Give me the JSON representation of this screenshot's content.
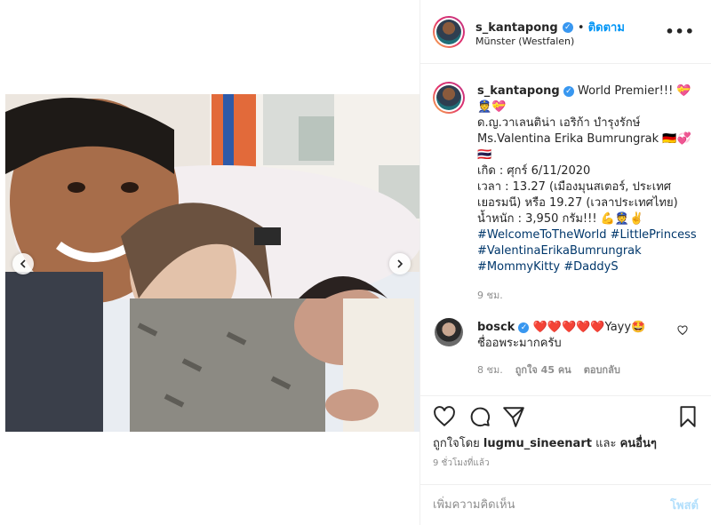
{
  "post": {
    "username": "s_kantapong",
    "follow_label": "ติดตาม",
    "location": "Münster (Westfalen)",
    "more_label": "•••"
  },
  "caption": {
    "username": "s_kantapong",
    "line1": "World Premier!!! 💝",
    "line2": "👮💝",
    "line3": "ด.ญ.วาเลนติน่า เอริก้า บำรุงรักษ์",
    "line4": "Ms.Valentina Erika Bumrungrak 🇩🇪💞",
    "line5": "🇹🇭",
    "line6": "เกิด : ศุกร์ 6/11/2020",
    "line7": "เวลา : 13.27 (เมืองมุนสเตอร์, ประเทศเยอรมนี) หรือ 19.27 (เวลาประเทศไทย)",
    "line8": "น้ำหนัก : 3,950 กรัม!!! 💪👮✌️",
    "tag1": "#WelcomeToTheWorld",
    "tag2": "#LittlePrincess",
    "tag3": "#ValentinaErikaBumrungrak",
    "tag4": "#MommyKitty",
    "tag5": "#DaddyS",
    "time": "9 ชม."
  },
  "comment": {
    "username": "bosck",
    "text1": "❤️❤️❤️❤️❤️Yayy🤩",
    "text2": "ชื่ออพระมากครับ",
    "time": "8 ชม.",
    "likes": "ถูกใจ 45 คน",
    "reply": "ตอบกลับ"
  },
  "likes": {
    "prefix": "ถูกใจโดย",
    "user": "lugmu_sineenart",
    "middle": "และ",
    "others": "คนอื่นๆ"
  },
  "timeago": "9 ชั่วโมงที่แล้ว",
  "add_comment": {
    "placeholder": "เพิ่มความคิดเห็น",
    "post_label": "โพสต์"
  },
  "colors": {
    "accent": "#0095f6",
    "verified": "#3897f0",
    "hashtag": "#00376b",
    "muted": "#8e8e8e"
  }
}
